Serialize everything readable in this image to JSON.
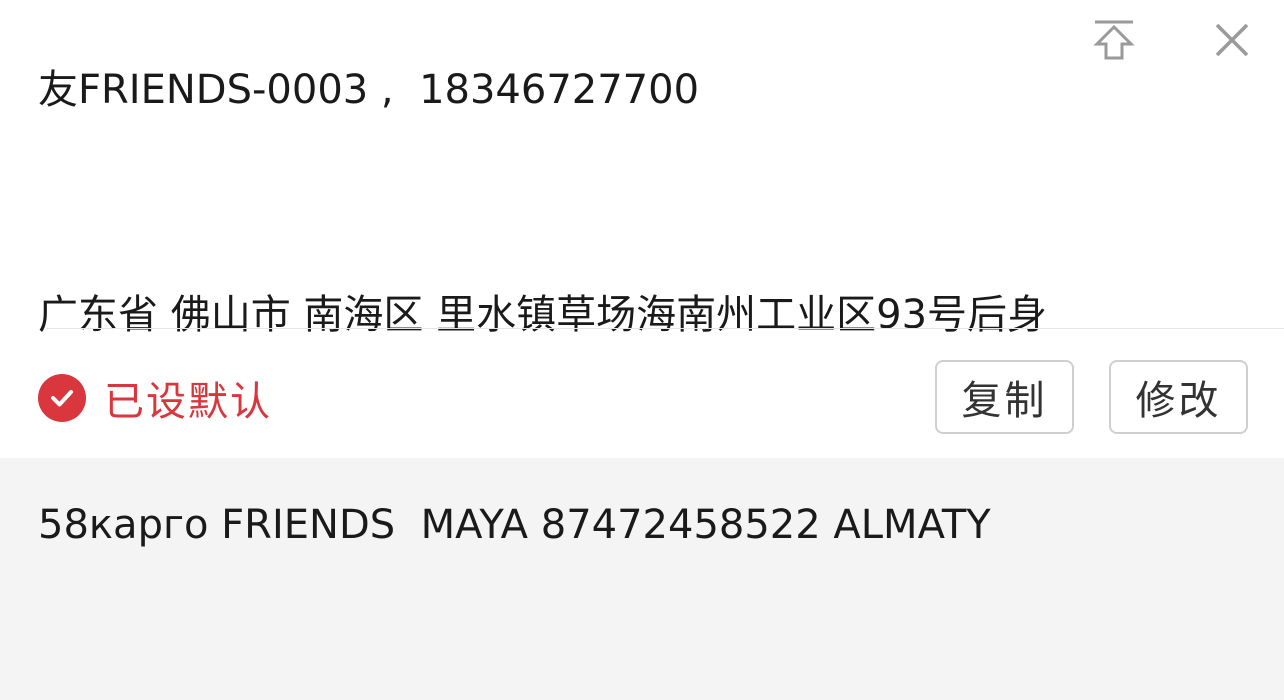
{
  "address_card": {
    "contact_line": "友FRIENDS-0003 ,  18346727700",
    "address_line_1": "广东省 佛山市 南海区 里水镇草场海南州工业区93号后身",
    "address_line_2": "58карго FRIENDS  MAYA 87472458522 ALMATY",
    "default_label": "已设默认",
    "copy_label": "复制",
    "edit_label": "修改",
    "icons": {
      "pin": "pin-to-top-icon",
      "close": "close-icon",
      "check": "check-circle-icon"
    },
    "colors": {
      "accent": "#d9363e",
      "text": "#1a1a1a"
    }
  }
}
